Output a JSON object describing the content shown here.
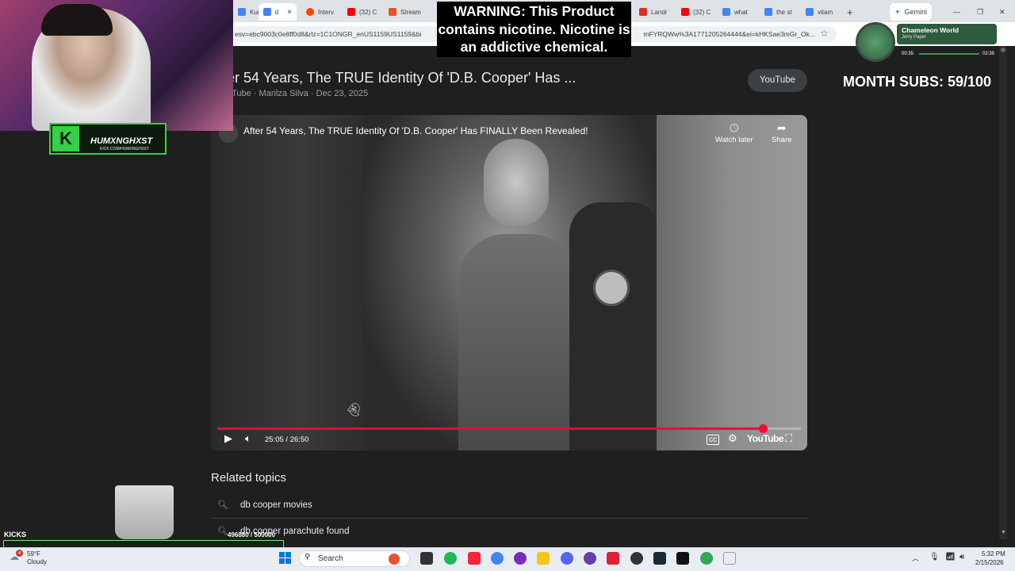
{
  "browser": {
    "tabs": [
      {
        "label": "Kurt C",
        "color": "#4285f4"
      },
      {
        "label": "d",
        "color": "#4285f4"
      },
      {
        "label": "Interv",
        "color": "#ff4500"
      },
      {
        "label": "(32) C",
        "color": "#ff0000"
      },
      {
        "label": "Stream",
        "color": "#e8542a"
      },
      {
        "label": "Landr",
        "color": "#d93025"
      },
      {
        "label": "(32) C",
        "color": "#ff0000"
      },
      {
        "label": "what",
        "color": "#4285f4"
      },
      {
        "label": "the st",
        "color": "#4285f4"
      },
      {
        "label": "vitam",
        "color": "#4285f4"
      }
    ],
    "active_tab_close": "×",
    "new_tab": "+",
    "gemini_label": "Gemini",
    "url": "esv=ebc9003c0e8ff0d8&rlz=1C1ONGR_enUS1159US1159&bi",
    "url_tail": "mFYRQWw%3A1771205264444&ei=kHKSae3mGr_Ok...",
    "window_controls": [
      "—",
      "❐",
      "✕"
    ]
  },
  "result": {
    "title": "ter 54 Years, The TRUE Identity Of 'D.B. Cooper' Has ...",
    "meta": "uTube · Marilza Silva · Dec 23, 2025",
    "source_pill": "YouTube"
  },
  "video": {
    "title": "After 54 Years, The TRUE Identity Of 'D.B. Cooper' Has FINALLY Been Revealed!",
    "watch_later": "Watch later",
    "share": "Share",
    "time": "25:05 / 26:50",
    "progress": 0.935,
    "youtube_logo": "YouTube"
  },
  "related": {
    "heading": "Related topics",
    "items": [
      "db cooper movies",
      "db cooper parachute found"
    ]
  },
  "overlays": {
    "warning": "WARNING: This Product contains nicotine. Nicotine is an addictive chemical.",
    "month_subs": "MONTH SUBS: 59/100",
    "streamer_name": "HUMXNGHXST",
    "streamer_sub": "KICK.COM/HUMXNGHXST",
    "music": {
      "song": "Chameleon World",
      "artist": "Jerry Paper",
      "elapsed": "00:35",
      "total": "02:39"
    },
    "kicks_label": "KICKS",
    "kicks_value": "496880 / 500000"
  },
  "taskbar": {
    "weather_temp": "59°F",
    "weather_cond": "Cloudy",
    "weather_badge": "4",
    "search_label": "Search",
    "time": "5:32 PM",
    "date": "2/15/2026",
    "app_colors": [
      "#1db954",
      "#fa243c",
      "#4285f4",
      "#7b2cbf",
      "#f5c518",
      "#5865f2",
      "#6441a5",
      "#e01e37",
      "#333333",
      "#1b2838",
      "#111111",
      "#34a853",
      "#ffffff"
    ]
  }
}
